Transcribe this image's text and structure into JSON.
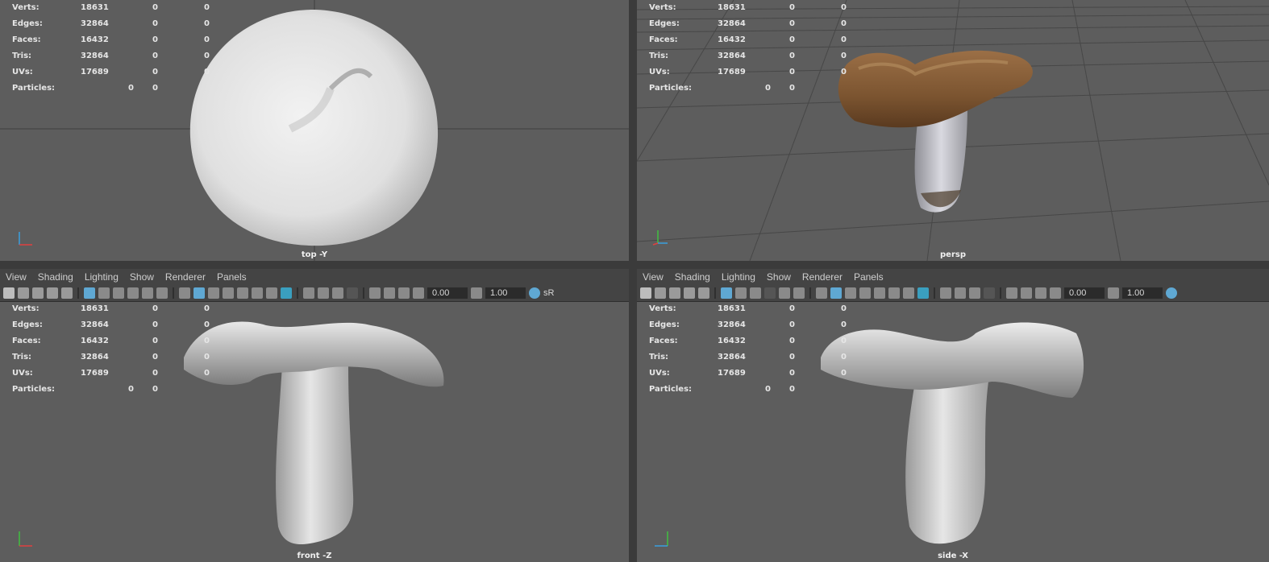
{
  "hud": {
    "labels": [
      "Verts:",
      "Edges:",
      "Faces:",
      "Tris:",
      "UVs:",
      "Particles:"
    ],
    "verts": [
      "18631",
      "0",
      "0"
    ],
    "edges": [
      "32864",
      "0",
      "0"
    ],
    "faces": [
      "16432",
      "0",
      "0"
    ],
    "tris": [
      "32864",
      "0",
      "0"
    ],
    "uvs": [
      "17689",
      "0",
      "0"
    ],
    "particles": [
      "0",
      "0"
    ]
  },
  "viewports": {
    "top": {
      "camera": "top -Y"
    },
    "persp": {
      "camera": "persp"
    },
    "front": {
      "camera": "front -Z"
    },
    "side": {
      "camera": "side -X"
    }
  },
  "menu": [
    "View",
    "Shading",
    "Lighting",
    "Show",
    "Renderer",
    "Panels"
  ],
  "toolbar": {
    "exposure": "0.00",
    "gamma": "1.00",
    "colorspace": "sR"
  },
  "colors": {
    "viewport_bg": "#5d5d5d",
    "panel_bg": "#444444",
    "highlight": "#5fa8d3"
  }
}
